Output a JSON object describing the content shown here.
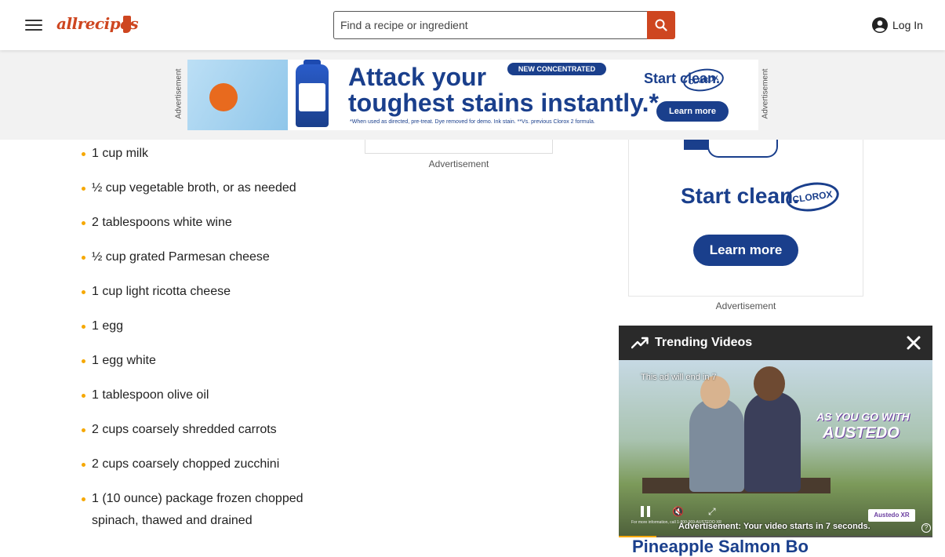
{
  "header": {
    "logo_text": "allrecipes",
    "search_placeholder": "Find a recipe or ingredient",
    "login_label": "Log In"
  },
  "top_ad": {
    "label": "Advertisement",
    "headline_line1": "Attack your",
    "headline_line2": "toughest stains instantly.*",
    "pill": "NEW CONCENTRATED",
    "start_clean": "Start clean.",
    "brand": "CLOROX",
    "learn_more": "Learn more",
    "fine_print": "*When used as directed, pre-treat. Dye removed for demo. Ink stain. **Vs. previous Clorox 2 formula.",
    "bottle_label": "STAIN REMOVER",
    "accent_color": "#1a3f8c"
  },
  "ingredients": [
    "1 cup milk",
    "½ cup vegetable broth, or as needed",
    "2 tablespoons white wine",
    "½ cup grated Parmesan cheese",
    "1 cup light ricotta cheese",
    "1 egg",
    "1 egg white",
    "1 tablespoon olive oil",
    "2 cups coarsely shredded carrots",
    "2 cups coarsely chopped zucchini",
    "1 (10 ounce) package frozen chopped spinach, thawed and drained"
  ],
  "mid_ad": {
    "label": "Advertisement"
  },
  "side_ad": {
    "start_clean": "Start clean.",
    "brand": "CLOROX",
    "learn_more": "Learn more",
    "label": "Advertisement"
  },
  "trending": {
    "title": "Trending Videos",
    "ad_countdown": "This ad will end in 7",
    "brand_line1": "AS YOU GO WITH",
    "brand_line2": "AUSTEDO",
    "brand_badge": "Austedo XR",
    "info_text": "For more information, call 1-800-969-AUSTEDO XR",
    "advertisement_text": "Advertisement: Your video starts in 7 seconds.",
    "progress": 0.12
  },
  "below_title": "Pineapple Salmon Bo"
}
